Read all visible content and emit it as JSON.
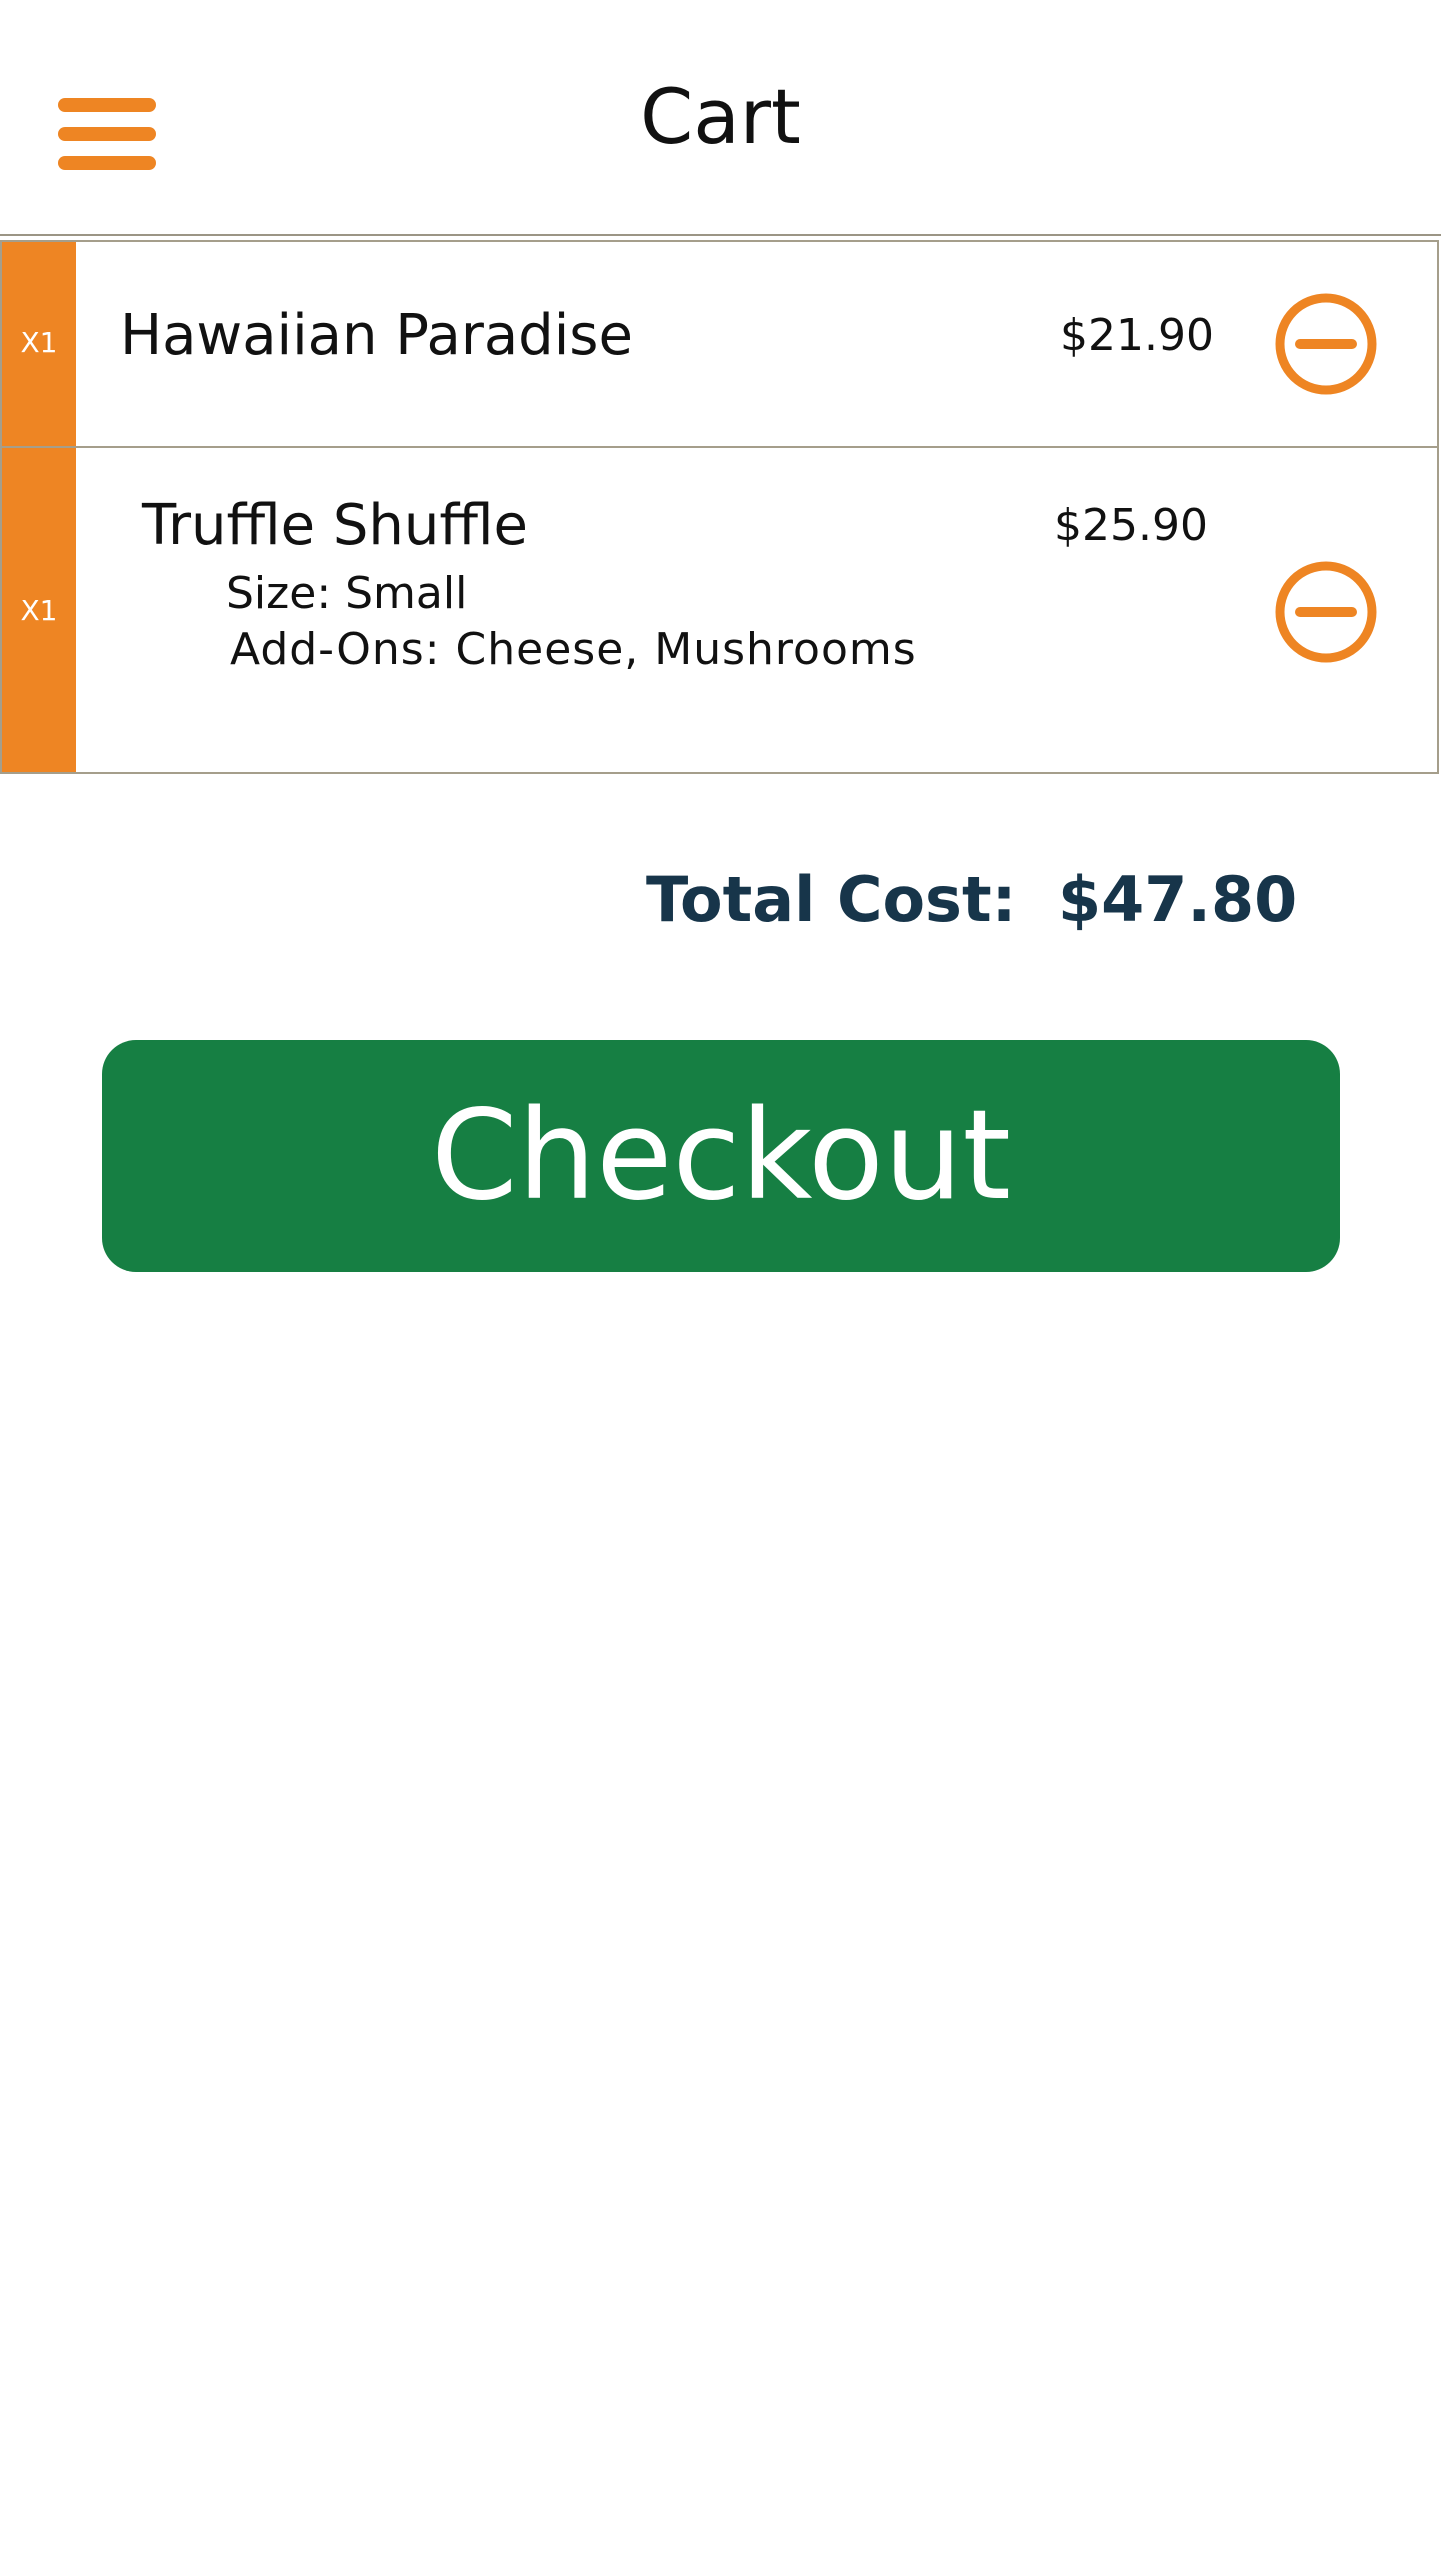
{
  "header": {
    "title": "Cart",
    "menu_icon": "hamburger-menu-icon"
  },
  "colors": {
    "accent": "#ee8523",
    "checkout_green": "#167f43",
    "total_text": "#17354a",
    "divider": "#9b9585"
  },
  "cart": {
    "items": [
      {
        "quantity": "X1",
        "name": "Hawaiian Paradise",
        "price": "$21.90",
        "remove_icon": "minus-circle-icon"
      },
      {
        "quantity": "X1",
        "name": "Truffle Shuffle",
        "price": "$25.90",
        "size": "Size: Small",
        "addons": "Add-Ons: Cheese, Mushrooms",
        "remove_icon": "minus-circle-icon"
      }
    ]
  },
  "total": {
    "label": "Total Cost:",
    "value": "$47.80"
  },
  "checkout": {
    "label": "Checkout"
  }
}
